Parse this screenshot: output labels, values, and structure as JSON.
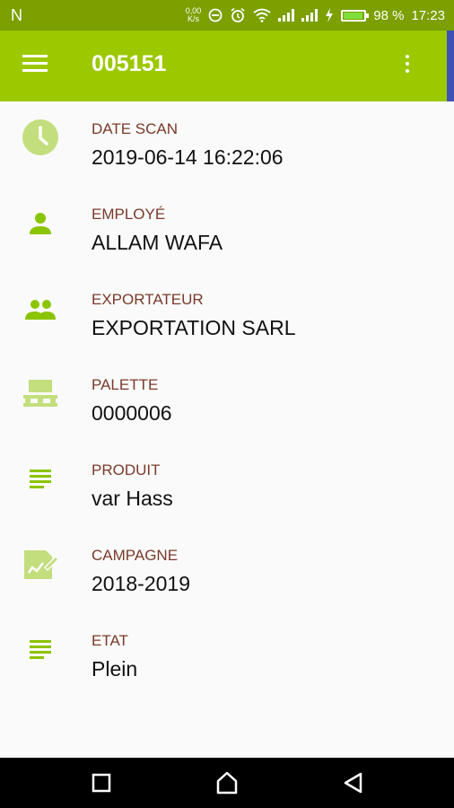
{
  "status_bar": {
    "carrier": "N",
    "net_speed_value": "0,00",
    "net_speed_unit": "K/s",
    "battery_percent": "98 %",
    "time": "17:23",
    "icons": [
      "do-not-disturb-icon",
      "alarm-icon",
      "wifi-icon",
      "signal-icon",
      "signal-icon",
      "charging-icon",
      "battery-icon"
    ]
  },
  "app_bar": {
    "title": "005151",
    "icons": [
      "menu-icon",
      "more-vert-icon"
    ]
  },
  "details": [
    {
      "icon": "clock-icon",
      "label": "DATE SCAN",
      "value": "2019-06-14 16:22:06"
    },
    {
      "icon": "person-icon",
      "label": "EMPLOYÉ",
      "value": "ALLAM WAFA"
    },
    {
      "icon": "people-icon",
      "label": "EXPORTATEUR",
      "value": "EXPORTATION SARL"
    },
    {
      "icon": "pallet-icon",
      "label": "PALETTE",
      "value": "0000006"
    },
    {
      "icon": "list-icon",
      "label": "PRODUIT",
      "value": "var Hass"
    },
    {
      "icon": "edit-document-icon",
      "label": "CAMPAGNE",
      "value": "2018-2019"
    },
    {
      "icon": "list-icon",
      "label": "ETAT",
      "value": "Plein"
    }
  ],
  "nav_bar": {
    "icons": [
      "recents-square-icon",
      "home-icon",
      "back-triangle-icon"
    ]
  },
  "colors": {
    "status_bar": "#7ba000",
    "app_bar": "#9cc800",
    "icon_green": "#8bc400",
    "label_brown": "#7a3a2a"
  }
}
